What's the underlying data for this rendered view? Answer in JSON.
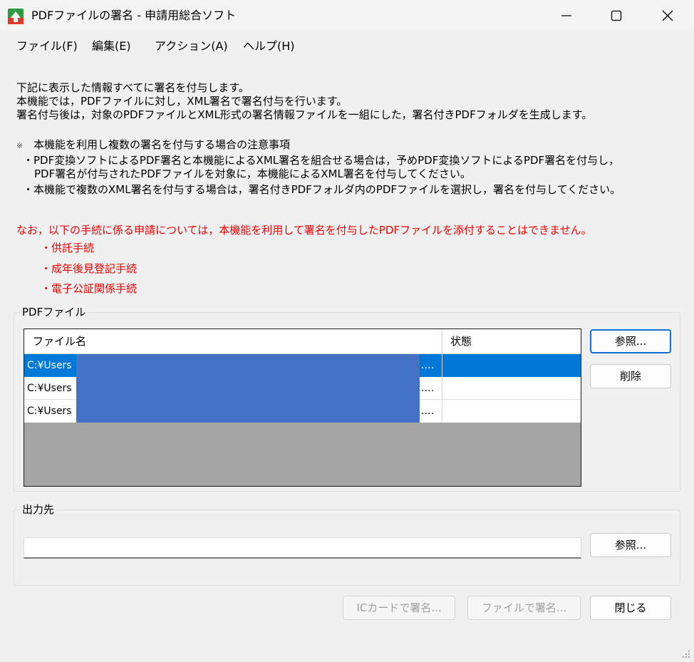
{
  "window": {
    "title": "PDFファイルの署名 - 申請用総合ソフト",
    "icon": "app-logo-icon",
    "controls": [
      "minimize-icon",
      "maximize-icon",
      "close-icon"
    ]
  },
  "menu": [
    "ファイル(F)",
    "編集(E)",
    "アクション(A)",
    "ヘルプ(H)"
  ],
  "info": {
    "lines": [
      "下記に表示した情報すべてに署名を付与します。",
      "本機能では，PDFファイルに対し，XML署名で署名付与を行います。",
      "署名付与後は，対象のPDFファイルとXML形式の署名情報ファイルを一組にした，署名付きPDFフォルダを生成します。"
    ],
    "note_mark": "※",
    "note_title": "本機能を利用し複数の署名を付与する場合の注意事項",
    "note_lines": [
      "・PDF変換ソフトによるPDF署名と本機能によるXML署名を組合せる場合は，予めPDF変換ソフトによるPDF署名を付与し，",
      "PDF署名が付与されたPDFファイルを対象に，本機能によるXML署名を付与してください。",
      "・本機能で複数のXML署名を付与する場合は，署名付きPDFフォルダ内のPDFファイルを選択し，署名を付与してください。"
    ],
    "warning": "なお，以下の手続に係る申請については，本機能を利用して署名を付与したPDFファイルを添付することはできません。",
    "excluded": [
      "・供託手続",
      "・成年後見登記手続",
      "・電子公証関係手続"
    ]
  },
  "pdf_group": {
    "label": "PDFファイル",
    "columns": [
      "ファイル名",
      "状態"
    ],
    "rows": [
      {
        "file": "C:¥Users",
        "suffix": "‥…",
        "status": "",
        "selected": true
      },
      {
        "file": "C:¥Users",
        "suffix": "‥…",
        "status": "",
        "selected": false
      },
      {
        "file": "C:¥Users",
        "suffix": "‥…",
        "status": "",
        "selected": false
      }
    ],
    "browse_label": "参照...",
    "delete_label": "削除"
  },
  "output_group": {
    "label": "出力先",
    "value": "",
    "browse_label": "参照..."
  },
  "footer": {
    "ic_sign_label": "ICカードで署名...",
    "file_sign_label": "ファイルで署名...",
    "close_label": "閉じる"
  },
  "colors": {
    "selection": "#0078d7",
    "warning_text": "#f00000",
    "redaction": "#4472c4",
    "list_background": "#a5a5a5",
    "default_button_border": "#1170cf"
  }
}
